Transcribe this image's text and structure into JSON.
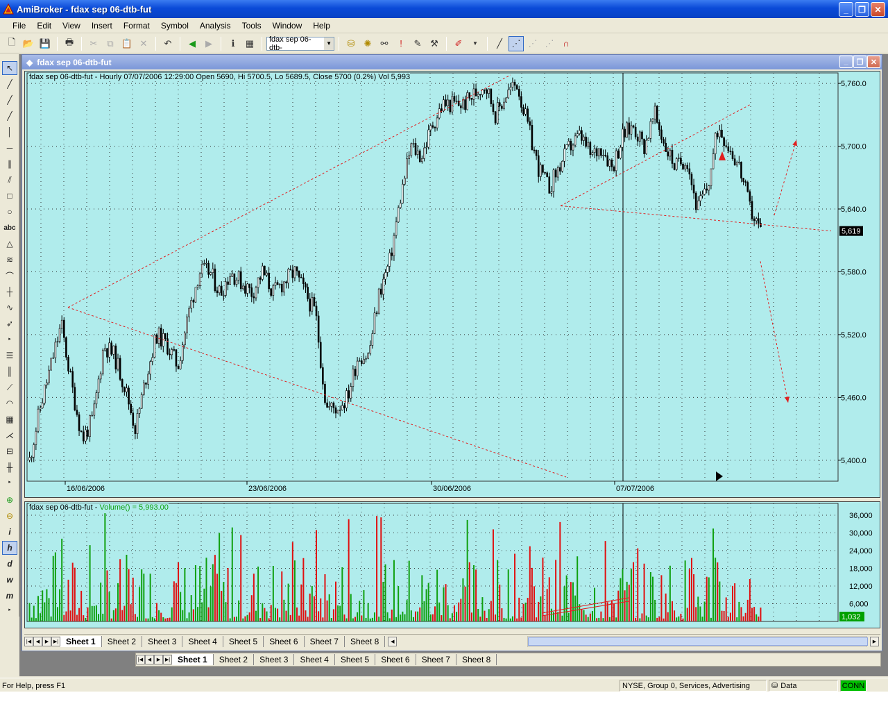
{
  "window": {
    "title": "AmiBroker - fdax sep 06-dtb-fut",
    "minimize": "_",
    "maximize": "❐",
    "close": "✕"
  },
  "menu": [
    "File",
    "Edit",
    "View",
    "Insert",
    "Format",
    "Symbol",
    "Analysis",
    "Tools",
    "Window",
    "Help"
  ],
  "toolbar": {
    "symbol_value": "fdax sep 06-dtb-"
  },
  "child_window": {
    "title": "fdax sep 06-dtb-fut"
  },
  "price_pane": {
    "header": "fdax sep 06-dtb-fut - Hourly 07/07/2006 12:29:00 Open 5690, Hi 5700.5, Lo 5689.5, Close 5700 (0.2%) Vol 5,993",
    "last_price_label": "5,619",
    "y_ticks": [
      "5,760.0",
      "5,700.0",
      "5,640.0",
      "5,580.0",
      "5,520.0",
      "5,460.0",
      "5,400.0"
    ],
    "x_labels": [
      "16/06/2006",
      "23/06/2006",
      "30/06/2006",
      "07/07/2006"
    ],
    "background": "#b0ecec",
    "trendline_color": "#e02020"
  },
  "volume_pane": {
    "header_symbol": "fdax sep 06-dtb-fut - ",
    "header_formula": "Volume() = 5,993.00",
    "y_ticks": [
      "36,000",
      "30,000",
      "24,000",
      "18,000",
      "12,000",
      "6,000"
    ],
    "last_volume_label": "1,032",
    "up_color": "#10a010",
    "down_color": "#e01010"
  },
  "chart_data": {
    "type": "candlestick",
    "title": "fdax sep 06-dtb-fut - Hourly",
    "ylim": [
      5380,
      5770
    ],
    "y_ticks": [
      5400,
      5460,
      5520,
      5580,
      5640,
      5700,
      5760
    ],
    "x_labels": [
      "16/06/2006",
      "23/06/2006",
      "30/06/2006",
      "07/07/2006"
    ],
    "close_path_approx": [
      5400,
      5450,
      5490,
      5530,
      5470,
      5420,
      5440,
      5510,
      5500,
      5470,
      5430,
      5480,
      5520,
      5510,
      5490,
      5540,
      5580,
      5580,
      5560,
      5580,
      5570,
      5560,
      5580,
      5560,
      5570,
      5580,
      5560,
      5540,
      5450,
      5450,
      5460,
      5500,
      5500,
      5560,
      5590,
      5650,
      5700,
      5690,
      5720,
      5740,
      5740,
      5740,
      5750,
      5760,
      5730,
      5750,
      5760,
      5720,
      5680,
      5660,
      5680,
      5700,
      5710,
      5690,
      5700,
      5680,
      5710,
      5720,
      5700,
      5730,
      5700,
      5680,
      5690,
      5640,
      5660,
      5720,
      5700,
      5680,
      5640,
      5620
    ],
    "volume_ylim": [
      0,
      40000
    ],
    "volume_ticks": [
      6000,
      12000,
      18000,
      24000,
      30000,
      36000
    ],
    "last_close": 5619,
    "last_volume": 1032
  },
  "sheets": [
    "Sheet 1",
    "Sheet 2",
    "Sheet 3",
    "Sheet 4",
    "Sheet 5",
    "Sheet 6",
    "Sheet 7",
    "Sheet 8"
  ],
  "status": {
    "help": "For Help, press F1",
    "market": "NYSE, Group 0, Services, Advertising",
    "data": "Data",
    "conn": "CONN"
  }
}
